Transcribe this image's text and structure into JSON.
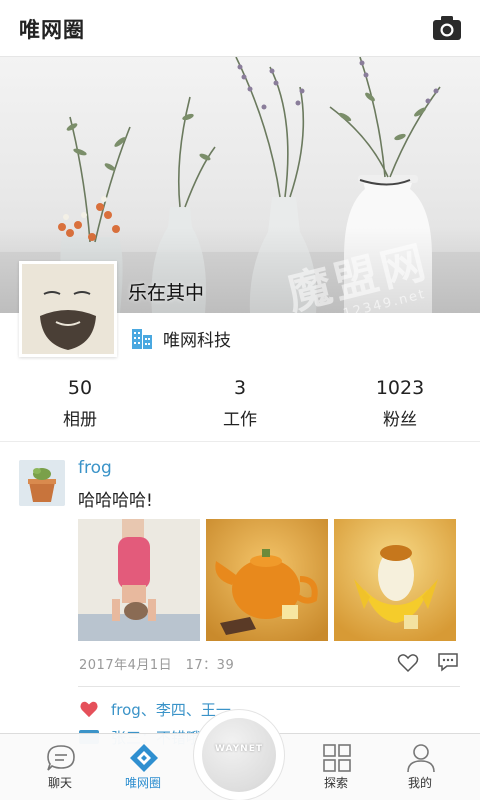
{
  "header": {
    "title": "唯网圈",
    "camera_icon": "camera-icon"
  },
  "cover": {
    "watermark": "魔盟网",
    "watermark_url": "www.12349.net"
  },
  "profile": {
    "name": "乐在其中",
    "company": "唯网科技",
    "company_icon": "building-icon"
  },
  "stats": [
    {
      "value": "50",
      "label": "相册"
    },
    {
      "value": "3",
      "label": "工作"
    },
    {
      "value": "1023",
      "label": "粉丝"
    }
  ],
  "post": {
    "user": "frog",
    "text": "哈哈哈哈!",
    "time": "2017年4月1日　17：39",
    "likes": "frog、李四、王一",
    "comment_preview": "张三：不错哦"
  },
  "nav": {
    "items": [
      {
        "label": "聊天",
        "icon": "chat-icon"
      },
      {
        "label": "唯网圈",
        "icon": "moments-icon"
      },
      {
        "label": "探索",
        "icon": "grid-icon"
      },
      {
        "label": "我的",
        "icon": "user-icon"
      }
    ],
    "center_label": "WAYNET"
  },
  "colors": {
    "accent": "#2f8fd0",
    "link": "#3a93c8",
    "like": "#e5505a"
  }
}
